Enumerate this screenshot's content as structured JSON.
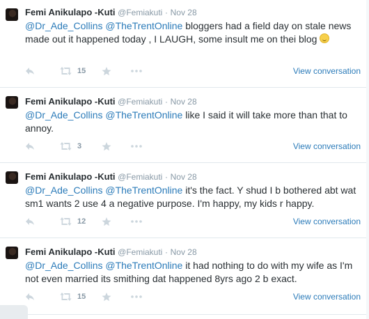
{
  "tweets": [
    {
      "fullname": "Femi Anikulapo -Kuti",
      "username": "@Femiakuti",
      "sep": "·",
      "time": "Nov 28",
      "mention1": "@Dr_Ade_Collins",
      "mention2": "@TheTrentOnline",
      "text": " bloggers had a field day on stale news made out it happened today , I LAUGH, some insult me on thei blog ",
      "emoji": "grinning-face-emoji",
      "retweets": "15",
      "view": "View conversation"
    },
    {
      "fullname": "Femi Anikulapo -Kuti",
      "username": "@Femiakuti",
      "sep": "·",
      "time": "Nov 28",
      "mention1": "@Dr_Ade_Collins",
      "mention2": "@TheTrentOnline",
      "text": " like I said it will take more than that to annoy.",
      "retweets": "3",
      "view": "View conversation"
    },
    {
      "fullname": "Femi Anikulapo -Kuti",
      "username": "@Femiakuti",
      "sep": "·",
      "time": "Nov 28",
      "mention1": "@Dr_Ade_Collins",
      "mention2": "@TheTrentOnline",
      "text": " it's the fact. Y shud I b bothered abt wat sm1 wants 2 use 4 a negative purpose. I'm happy, my kids r happy.",
      "retweets": "12",
      "view": "View conversation"
    },
    {
      "fullname": "Femi Anikulapo -Kuti",
      "username": "@Femiakuti",
      "sep": "·",
      "time": "Nov 28",
      "mention1": "@Dr_Ade_Collins",
      "mention2": "@TheTrentOnline",
      "text": " it had nothing to do with my wife as I'm not even married its smithing dat happened 8yrs ago 2 b exact.",
      "retweets": "15",
      "view": "View conversation"
    }
  ],
  "icons": {
    "reply": "reply-icon",
    "retweet": "retweet-icon",
    "favorite": "star-icon",
    "more": "more-dots-icon"
  },
  "colors": {
    "link": "#2b7bb9",
    "muted": "#8899a6",
    "icon": "#ccd6dd",
    "divider": "#e1e8ed"
  }
}
